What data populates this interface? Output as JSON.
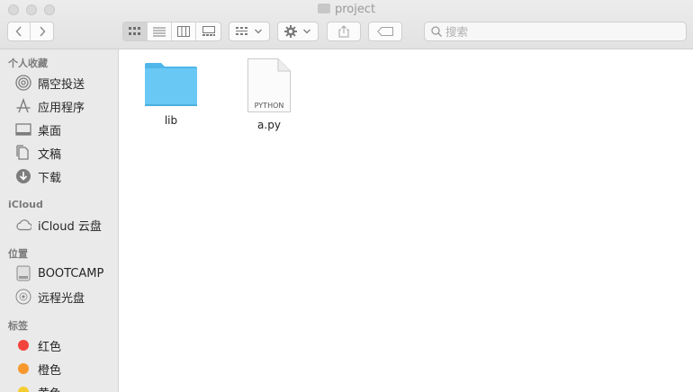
{
  "window": {
    "title": "project"
  },
  "toolbar": {
    "view_modes": [
      "icon-view",
      "list-view",
      "column-view",
      "gallery-view"
    ],
    "active_view": "icon-view"
  },
  "search": {
    "placeholder": "搜索"
  },
  "sidebar": {
    "favorites": {
      "title": "个人收藏",
      "items": [
        {
          "label": "隔空投送",
          "icon": "airdrop-icon"
        },
        {
          "label": "应用程序",
          "icon": "applications-icon"
        },
        {
          "label": "桌面",
          "icon": "desktop-icon"
        },
        {
          "label": "文稿",
          "icon": "documents-icon"
        },
        {
          "label": "下载",
          "icon": "downloads-icon"
        }
      ]
    },
    "icloud": {
      "title": "iCloud",
      "items": [
        {
          "label": "iCloud 云盘",
          "icon": "cloud-icon"
        }
      ]
    },
    "locations": {
      "title": "位置",
      "items": [
        {
          "label": "BOOTCAMP",
          "icon": "disk-icon"
        },
        {
          "label": "远程光盘",
          "icon": "optical-disc-icon"
        }
      ]
    },
    "tags": {
      "title": "标签",
      "items": [
        {
          "label": "红色",
          "color": "#f2443d"
        },
        {
          "label": "橙色",
          "color": "#f6982d"
        },
        {
          "label": "黄色",
          "color": "#f5cc2f"
        }
      ]
    }
  },
  "files": [
    {
      "name": "lib",
      "kind": "folder",
      "icon": "folder-icon"
    },
    {
      "name": "a.py",
      "kind": "python",
      "icon": "python-file-icon",
      "badge": "PYTHON"
    }
  ]
}
